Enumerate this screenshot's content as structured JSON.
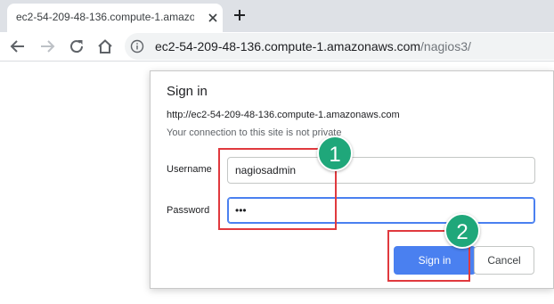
{
  "browser": {
    "tab_title": "ec2-54-209-48-136.compute-1.amazo",
    "url_host": "ec2-54-209-48-136.compute-1.amazonaws.com",
    "url_path": "/nagios3/"
  },
  "dialog": {
    "title": "Sign in",
    "site_url": "http://ec2-54-209-48-136.compute-1.amazonaws.com",
    "warning": "Your connection to this site is not private",
    "username_label": "Username",
    "username_value": "nagiosadmin",
    "password_label": "Password",
    "password_value": "•••",
    "signin_label": "Sign in",
    "cancel_label": "Cancel"
  },
  "annotations": {
    "step1": "1",
    "step2": "2",
    "highlight_color": "#e0393e",
    "badge_color": "#1fa77a"
  },
  "colors": {
    "accent": "#4a80f0"
  }
}
